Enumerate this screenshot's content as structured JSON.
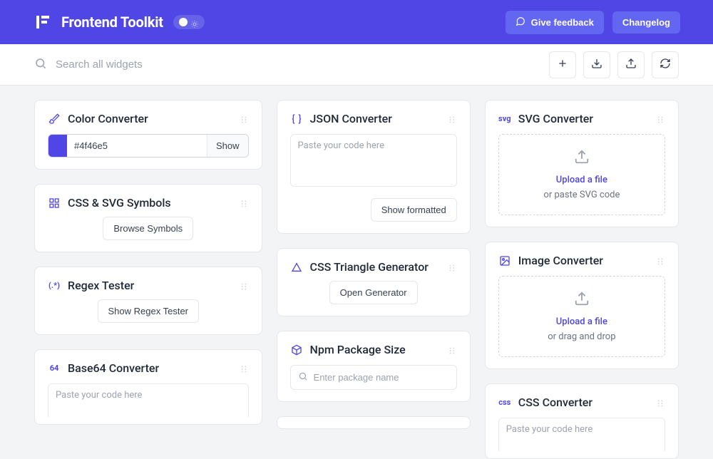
{
  "header": {
    "title": "Frontend Toolkit",
    "feedback": "Give feedback",
    "changelog": "Changelog"
  },
  "toolbar": {
    "search_placeholder": "Search all widgets"
  },
  "col1": {
    "color": {
      "title": "Color Converter",
      "value": "#4f46e5",
      "show": "Show"
    },
    "symbols": {
      "title": "CSS & SVG Symbols",
      "btn": "Browse Symbols"
    },
    "regex": {
      "title": "Regex Tester",
      "btn": "Show Regex Tester"
    },
    "base64": {
      "title": "Base64 Converter",
      "placeholder": "Paste your code here",
      "icon": "64"
    }
  },
  "col2": {
    "json": {
      "title": "JSON Converter",
      "placeholder": "Paste your code here",
      "btn": "Show formatted"
    },
    "triangle": {
      "title": "CSS Triangle Generator",
      "btn": "Open Generator"
    },
    "npm": {
      "title": "Npm Package Size",
      "placeholder": "Enter package name"
    }
  },
  "col3": {
    "svg": {
      "title": "SVG Converter",
      "icon": "svg",
      "uploadLink": "Upload a file",
      "uploadSub": "or paste SVG code"
    },
    "image": {
      "title": "Image Converter",
      "uploadLink": "Upload a file",
      "uploadSub": "or drag and drop"
    },
    "css": {
      "title": "CSS Converter",
      "icon": "css",
      "placeholder": "Paste your code here"
    }
  }
}
